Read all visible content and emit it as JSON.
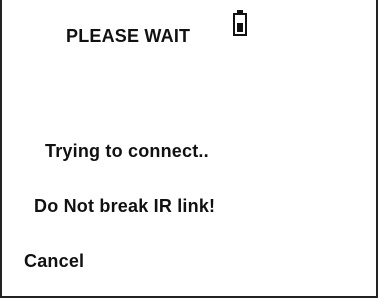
{
  "screen": {
    "title": "PLEASE WAIT",
    "status_line": "Trying to connect..",
    "warning_line": "Do Not break IR link!",
    "cancel_label": "Cancel"
  },
  "icons": {
    "battery": {
      "name": "battery-icon",
      "charge_fraction": 0.6
    }
  },
  "colors": {
    "background": "#ffffff",
    "foreground": "#111111",
    "border": "#222222"
  }
}
